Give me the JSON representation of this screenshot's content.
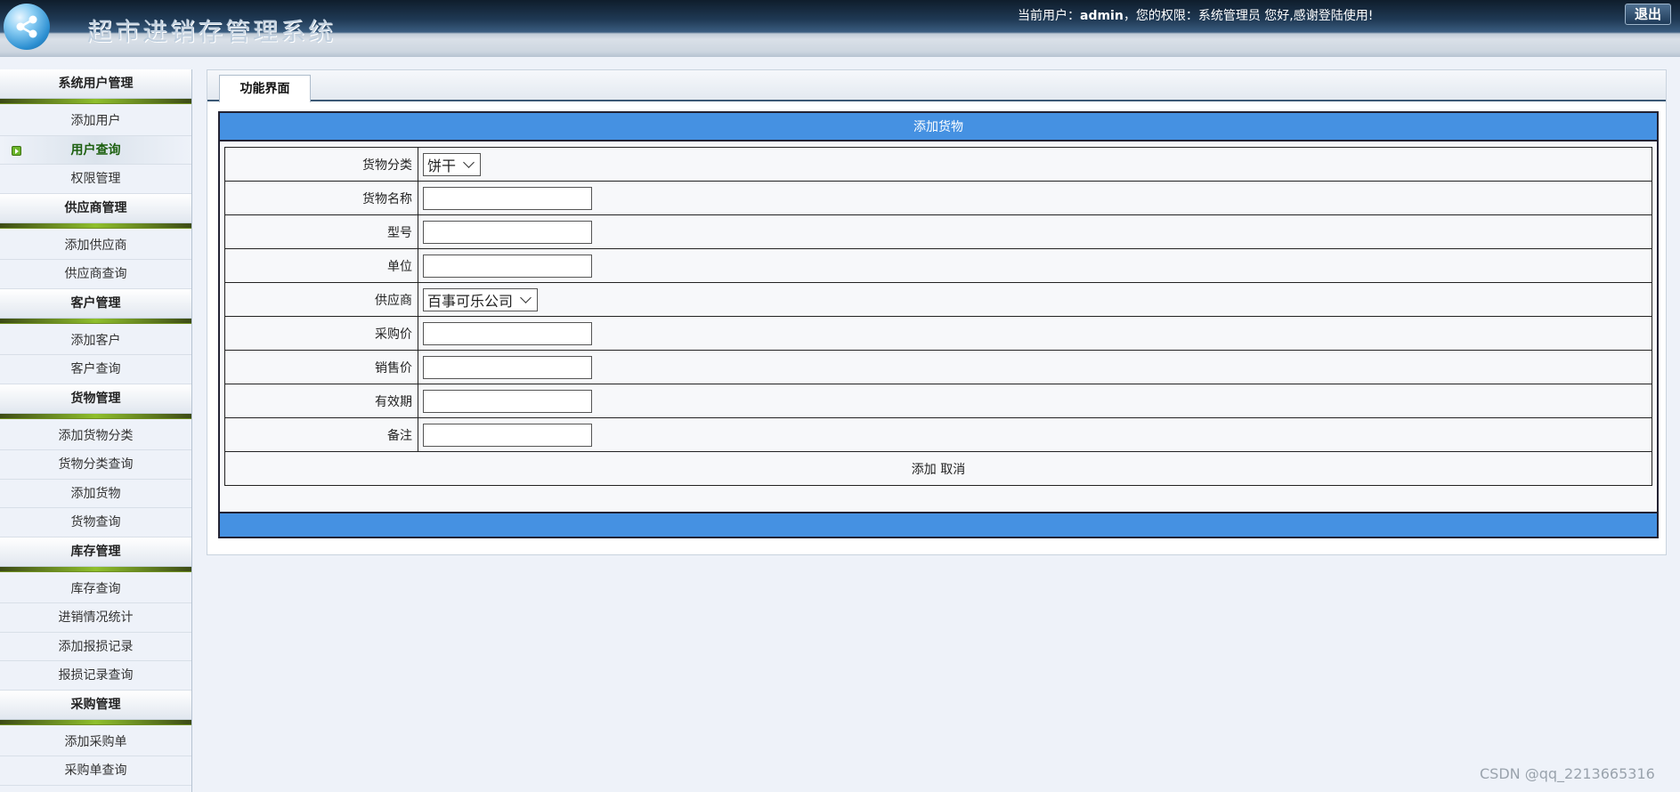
{
  "header": {
    "title": "超市进销存管理系统",
    "user_prefix": "当前用户：",
    "username": "admin",
    "role_text": "，您的权限：系统管理员 您好,感谢登陆使用!",
    "logout": "退出"
  },
  "sidebar": {
    "sections": [
      {
        "title": "系统用户管理",
        "items": [
          "添加用户",
          "用户查询",
          "权限管理"
        ]
      },
      {
        "title": "供应商管理",
        "items": [
          "添加供应商",
          "供应商查询"
        ]
      },
      {
        "title": "客户管理",
        "items": [
          "添加客户",
          "客户查询"
        ]
      },
      {
        "title": "货物管理",
        "items": [
          "添加货物分类",
          "货物分类查询",
          "添加货物",
          "货物查询"
        ]
      },
      {
        "title": "库存管理",
        "items": [
          "库存查询",
          "进销情况统计",
          "添加报损记录",
          "报损记录查询"
        ]
      },
      {
        "title": "采购管理",
        "items": [
          "添加采购单",
          "采购单查询"
        ]
      }
    ],
    "active_item": "用户查询"
  },
  "main": {
    "tab": "功能界面",
    "form_title": "添加货物",
    "fields": {
      "category": {
        "label": "货物分类",
        "selected": "饼干"
      },
      "name": {
        "label": "货物名称",
        "value": ""
      },
      "model": {
        "label": "型号",
        "value": ""
      },
      "unit": {
        "label": "单位",
        "value": ""
      },
      "supplier": {
        "label": "供应商",
        "selected": "百事可乐公司"
      },
      "purchase_price": {
        "label": "采购价",
        "value": ""
      },
      "sale_price": {
        "label": "销售价",
        "value": ""
      },
      "expiry": {
        "label": "有效期",
        "value": ""
      },
      "remark": {
        "label": "备注",
        "value": ""
      }
    },
    "add": "添加",
    "cancel": "取消"
  },
  "watermark": "CSDN @qq_2213665316"
}
